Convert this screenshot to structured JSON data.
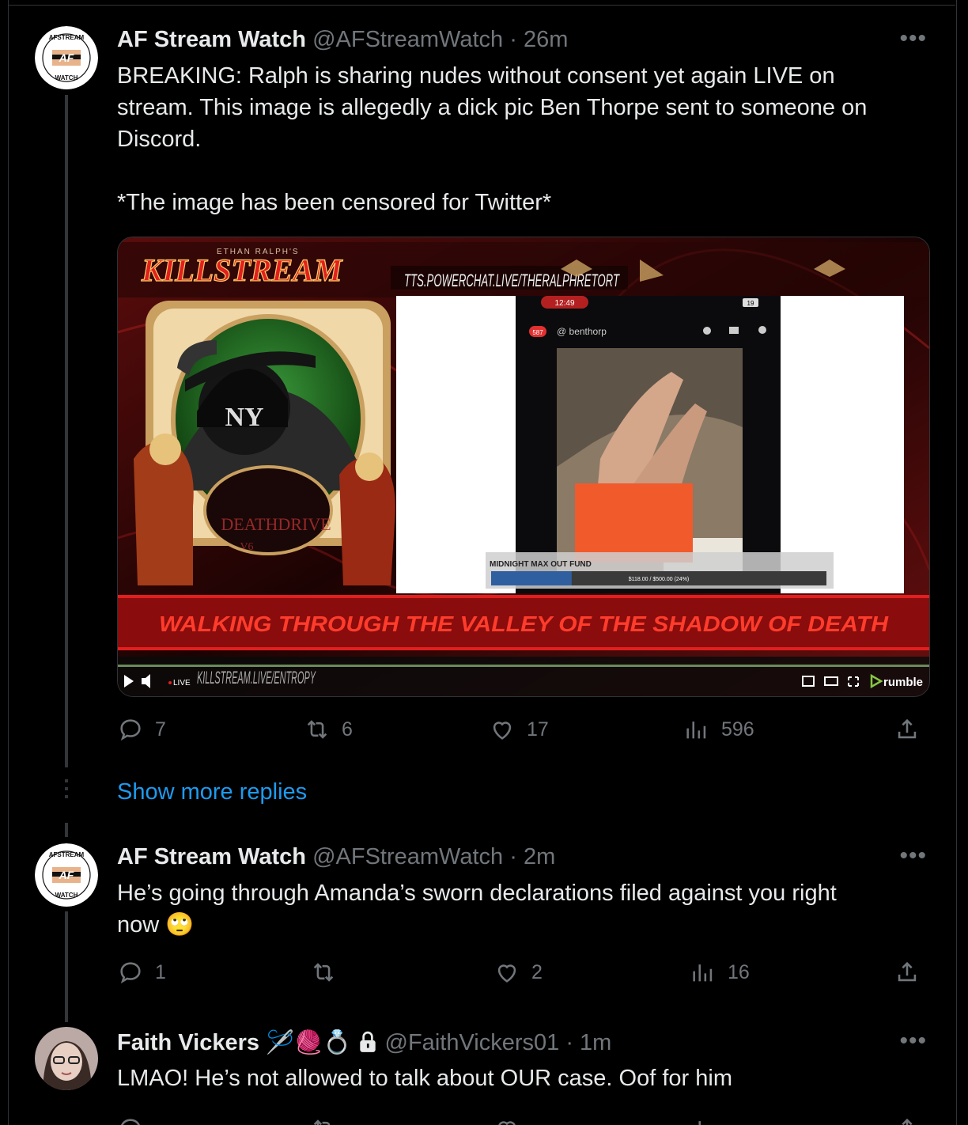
{
  "tweets": [
    {
      "name": "AF Stream Watch",
      "handle": "@AFStreamWatch",
      "time": "26m",
      "text_lines": [
        "BREAKING: Ralph is sharing nudes without consent yet again LIVE on",
        "stream. This image is allegedly a dick pic Ben Thorpe sent to someone on",
        "Discord.",
        "",
        "*The image has been censored for Twitter*"
      ],
      "replies": "7",
      "retweets": "6",
      "likes": "17",
      "views": "596"
    },
    {
      "name": "AF Stream Watch",
      "handle": "@AFStreamWatch",
      "time": "2m",
      "text_lines": [
        "He’s going through Amanda’s sworn declarations filed against you right",
        "now 🙄"
      ],
      "replies": "1",
      "retweets": "",
      "likes": "2",
      "views": "16"
    },
    {
      "name": "Faith Vickers",
      "name_emojis": "🪡🧶💍",
      "handle": "@FaithVickers01",
      "time": "1m",
      "text_lines": [
        "LMAO! He’s not allowed to talk about OUR case. Oof for him"
      ]
    }
  ],
  "separator": "·",
  "show_more_replies": "Show more replies",
  "avatar_logo": {
    "top_text": "AFSTREAM",
    "bottom_text": "WATCH",
    "center": "AF"
  },
  "media": {
    "brand_small": "ETHAN RALPH'S",
    "brand_big": "KILLSTREAM",
    "url_banner": "TTS.POWERCHAT.LIVE/THERALPHRETORT",
    "phone_time": "12:49",
    "phone_battery": "19",
    "phone_badge": "587",
    "phone_user": "@ benthorp",
    "webcam_cap": "NY",
    "webcam_mark": "DEATHDRIVE",
    "webcam_mark_sub": "V6",
    "fund_label": "MIDNIGHT MAX OUT FUND",
    "fund_amount": "$118.00 / $500.00 (24%)",
    "fund_progress": 0.24,
    "ticker": "WALKING THROUGH THE VALLEY OF THE SHADOW OF DEATH",
    "bottom_url": "KILLSTREAM.LIVE/ENTROPY",
    "live_label": "LIVE",
    "player_brand": "rumble",
    "colors": {
      "accent": "#e21f1f",
      "progress": "#2f5f9e",
      "censor": "#f15a2b"
    }
  },
  "colors": {
    "link": "#1d9bf0",
    "muted": "#71767b",
    "text": "#e7e9ea"
  }
}
